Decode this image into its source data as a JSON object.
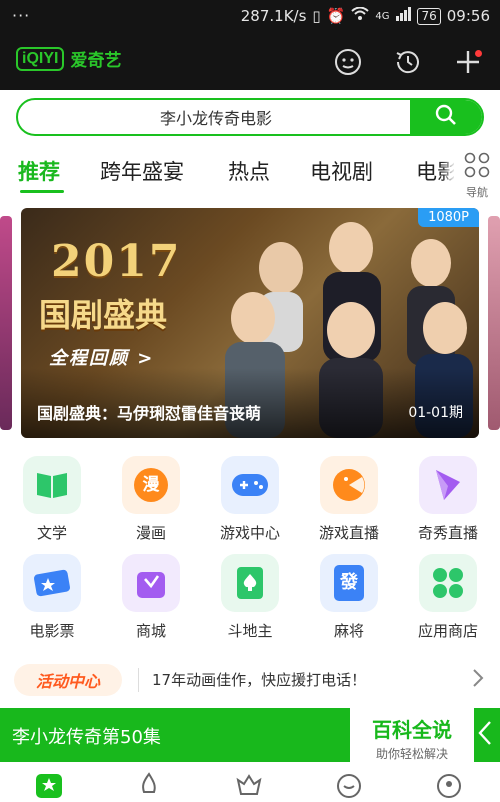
{
  "status": {
    "left": "···",
    "speed": "287.1K/s",
    "network": "4G",
    "battery": "76",
    "time": "09:56"
  },
  "brand": {
    "mark": "iQIYI",
    "name": "爱奇艺",
    "color": "#19c01e"
  },
  "search": {
    "query": "李小龙传奇电影"
  },
  "tabs": [
    {
      "label": "推荐",
      "active": true
    },
    {
      "label": "跨年盛宴",
      "active": false
    },
    {
      "label": "热点",
      "active": false
    },
    {
      "label": "电视剧",
      "active": false
    },
    {
      "label": "电影",
      "active": false
    }
  ],
  "nav": {
    "label": "导航"
  },
  "banner": {
    "year": "2017",
    "title_art": "国剧盛典",
    "review": "全程回顾 >",
    "quality": "1080P",
    "caption": "国剧盛典：马伊琍怼雷佳音丧萌",
    "date": "01-01期"
  },
  "grid": [
    {
      "label": "文学",
      "icon": "book-icon",
      "color": "#2dc66a",
      "bg": "#e8f8ee"
    },
    {
      "label": "漫画",
      "icon": "comic-icon",
      "color": "#ff8a1c",
      "bg": "#fff1e3"
    },
    {
      "label": "游戏中心",
      "icon": "gamepad-icon",
      "color": "#3b82f6",
      "bg": "#e8f0fe"
    },
    {
      "label": "游戏直播",
      "icon": "game-live-icon",
      "color": "#ff8a1c",
      "bg": "#fff1e3"
    },
    {
      "label": "奇秀直播",
      "icon": "show-live-icon",
      "color": "#a35cf0",
      "bg": "#f2eafd"
    },
    {
      "label": "电影票",
      "icon": "ticket-icon",
      "color": "#3b82f6",
      "bg": "#e8f0fe"
    },
    {
      "label": "商城",
      "icon": "shop-bag-icon",
      "color": "#a35cf0",
      "bg": "#f2eafd"
    },
    {
      "label": "斗地主",
      "icon": "poker-icon",
      "color": "#2dc66a",
      "bg": "#e8f8ee"
    },
    {
      "label": "麻将",
      "icon": "mahjong-icon",
      "color": "#3b82f6",
      "bg": "#e8f0fe"
    },
    {
      "label": "应用商店",
      "icon": "apps-icon",
      "color": "#2dc66a",
      "bg": "#e8f8ee"
    }
  ],
  "activity": {
    "badge": "活动中心",
    "text": "17年动画佳作，快应援打电话！"
  },
  "bottom_banner": {
    "title": "李小龙传奇第50集",
    "watermark_title": "百科全说",
    "watermark_sub": "助你轻松解决"
  }
}
